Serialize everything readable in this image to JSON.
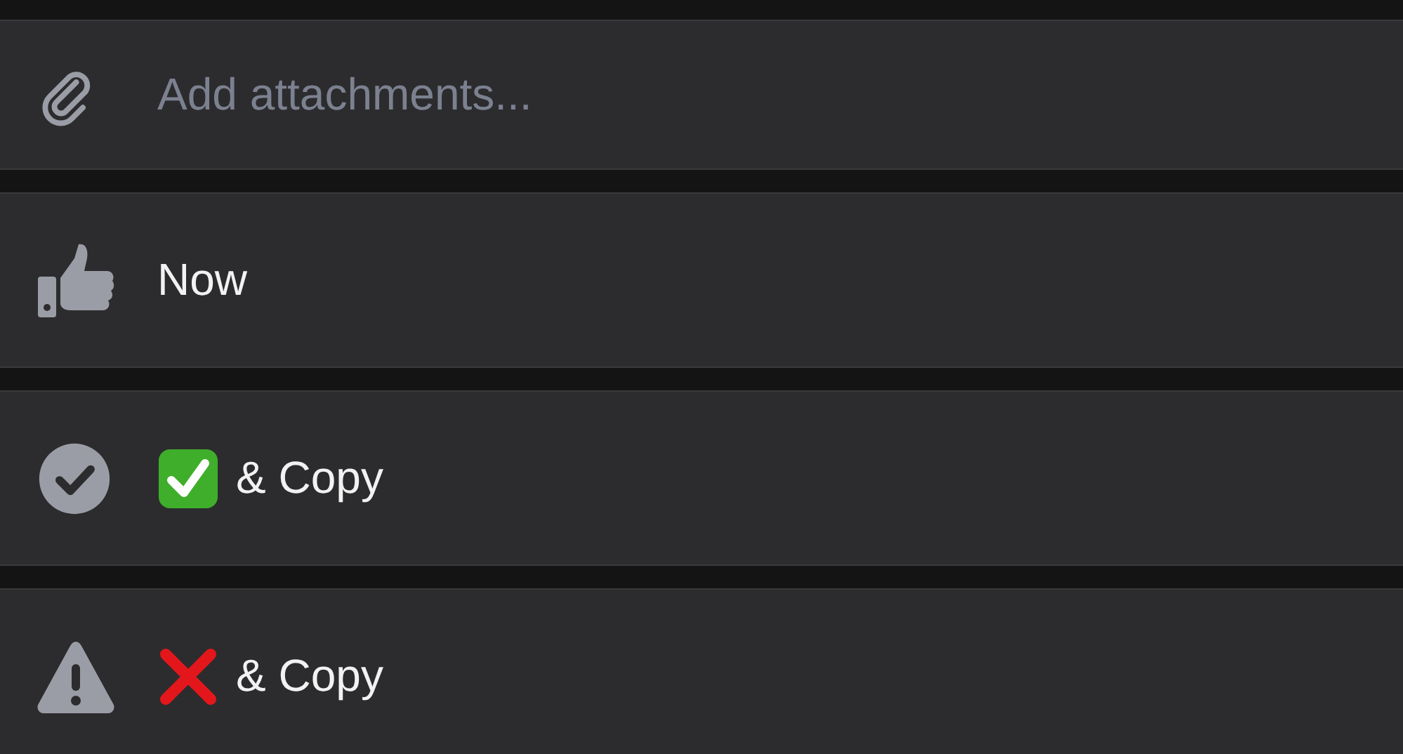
{
  "rows": [
    {
      "kind": "attach",
      "label": "Add attachments...",
      "dimmed": true
    },
    {
      "kind": "like",
      "label": "Now",
      "dimmed": false
    },
    {
      "kind": "done",
      "label": "& Copy",
      "dimmed": false
    },
    {
      "kind": "warn",
      "label": "& Copy",
      "dimmed": false
    }
  ]
}
